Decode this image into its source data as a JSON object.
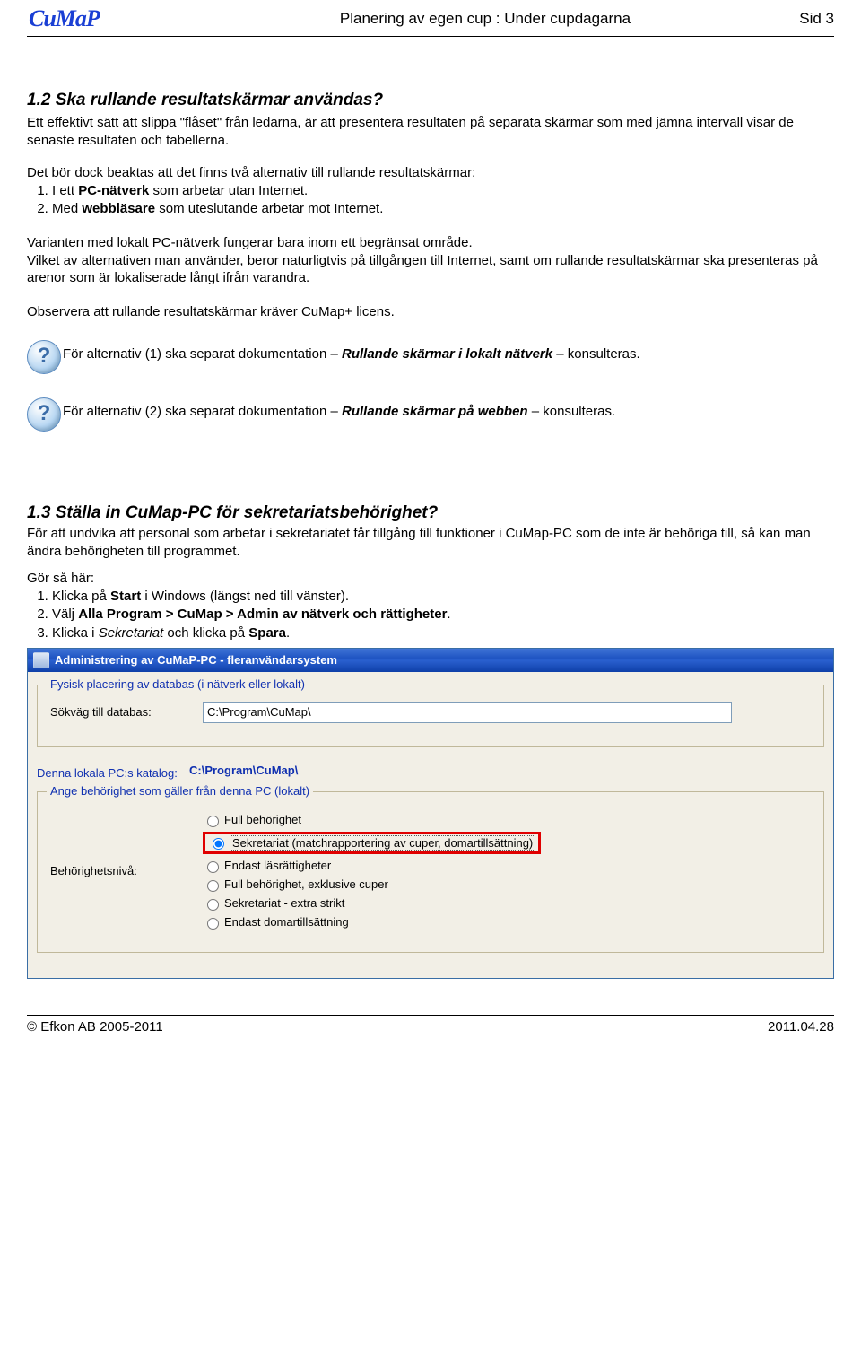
{
  "header": {
    "logo": "CuMaP",
    "title": "Planering av egen cup : Under cupdagarna",
    "page": "Sid 3"
  },
  "s12": {
    "heading": "1.2   Ska rullande resultatskärmar användas?",
    "p1": "Ett effektivt sätt att slippa \"flåset\" från ledarna, är att presentera resultaten på separata skärmar som med jämna intervall visar de senaste resultaten och tabellerna.",
    "p2_intro": "Det bör dock beaktas att det finns två alternativ till rullande resultatskärmar:",
    "li1_a": "I ett ",
    "li1_b": "PC-nätverk",
    "li1_c": " som arbetar utan Internet.",
    "li2_a": "Med ",
    "li2_b": "webbläsare",
    "li2_c": " som uteslutande arbetar mot Internet.",
    "p3": "Varianten med lokalt PC-nätverk fungerar bara inom ett begränsat område.",
    "p4": "Vilket av alternativen man använder, beror naturligtvis på tillgången till Internet, samt om rullande resultatskärmar ska presenteras på arenor som är lokaliserade långt ifrån varandra.",
    "p5": "Observera att rullande resultatskärmar kräver CuMap+ licens.",
    "note1_a": "För alternativ (1) ska separat dokumentation – ",
    "note1_b": "Rullande skärmar i lokalt nätverk",
    "note1_c": " – konsulteras.",
    "note2_a": "För alternativ (2) ska separat dokumentation – ",
    "note2_b": "Rullande skärmar på webben",
    "note2_c": " – konsulteras."
  },
  "s13": {
    "heading": "1.3   Ställa in CuMap-PC för sekretariatsbehörighet?",
    "p1": "För att undvika att personal som arbetar i sekretariatet får tillgång till funktioner i CuMap-PC som de inte är behöriga till, så kan man ändra behörigheten till programmet.",
    "steps_label": "Gör så här:",
    "li1_a": "Klicka på ",
    "li1_b": "Start",
    "li1_c": " i Windows (längst ned till vänster).",
    "li2_a": "Välj ",
    "li2_b": "Alla Program > CuMap > Admin av nätverk och rättigheter",
    "li2_c": ".",
    "li3_a": "Klicka i ",
    "li3_b": "Sekretariat",
    "li3_c": " och klicka på ",
    "li3_d": "Spara",
    "li3_e": "."
  },
  "win": {
    "title": "Administrering av CuMaP-PC  - fleranvändarsystem",
    "group1_legend": "Fysisk placering av databas (i nätverk eller lokalt)",
    "db_label": "Sökväg till databas:",
    "db_value": "C:\\Program\\CuMap\\",
    "local_label": "Denna lokala PC:s katalog:",
    "local_value": "C:\\Program\\CuMap\\",
    "group2_legend": "Ange behörighet som gäller från denna PC (lokalt)",
    "level_label": "Behörighetsnivå:",
    "radios": {
      "r0": "Full behörighet",
      "r1": "Sekretariat (matchrapportering av cuper, domartillsättning)",
      "r2": "Endast läsrättigheter",
      "r3": "Full behörighet, exklusive cuper",
      "r4": "Sekretariat - extra strikt",
      "r5": "Endast domartillsättning"
    }
  },
  "footer": {
    "left": "© Efkon AB 2005-2011",
    "right": "2011.04.28"
  }
}
